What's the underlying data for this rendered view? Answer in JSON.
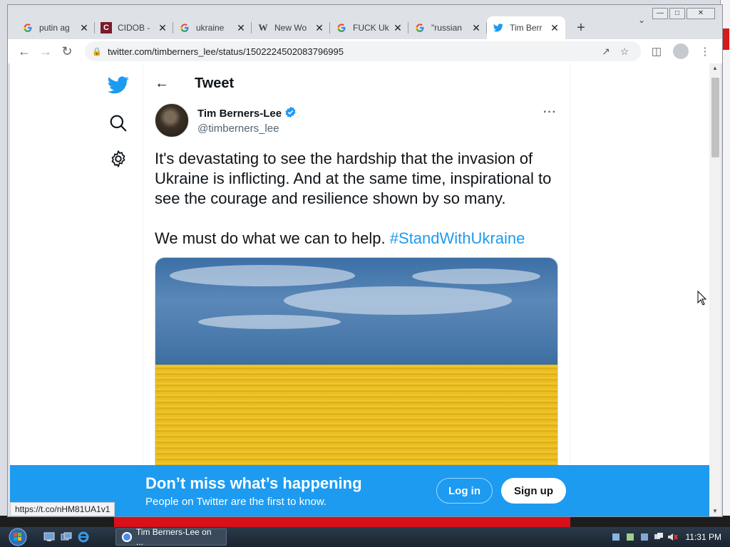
{
  "browser": {
    "tabs": [
      {
        "title": "putin ag",
        "favicon": "google-icon",
        "active": false
      },
      {
        "title": "CIDOB -",
        "favicon": "cidob-icon",
        "active": false
      },
      {
        "title": "ukraine",
        "favicon": "google-icon",
        "active": false
      },
      {
        "title": "New Wo",
        "favicon": "wikipedia-icon",
        "active": false
      },
      {
        "title": "FUCK Uk",
        "favicon": "google-icon",
        "active": false
      },
      {
        "title": "\"russian",
        "favicon": "google-icon",
        "active": false
      },
      {
        "title": "Tim Berr",
        "favicon": "twitter-icon",
        "active": true
      }
    ],
    "new_tab": "+",
    "url": "twitter.com/timberners_lee/status/1502224502083796995",
    "status_link": "https://t.co/nHM81UA1v1"
  },
  "page": {
    "header_title": "Tweet",
    "author": {
      "name": "Tim Berners-Lee",
      "handle": "@timberners_lee"
    },
    "tweet": {
      "paragraph1": "It's devastating to see the hardship that the invasion of Ukraine is inflicting. And at the same time, inspirational to see the courage and resilience shown by so many.",
      "paragraph2_text": "We must do what we can to help.",
      "hashtag": "#StandWithUkraine"
    },
    "banner": {
      "title": "Don’t miss what’s happening",
      "subtitle": "People on Twitter are the first to know.",
      "login": "Log in",
      "signup": "Sign up"
    }
  },
  "taskbar": {
    "task_title": "Tim Berners-Lee on ...",
    "clock": "11:31 PM"
  },
  "colors": {
    "twitter_blue": "#1d9bf0",
    "text_primary": "#0f1419",
    "text_secondary": "#536471"
  }
}
